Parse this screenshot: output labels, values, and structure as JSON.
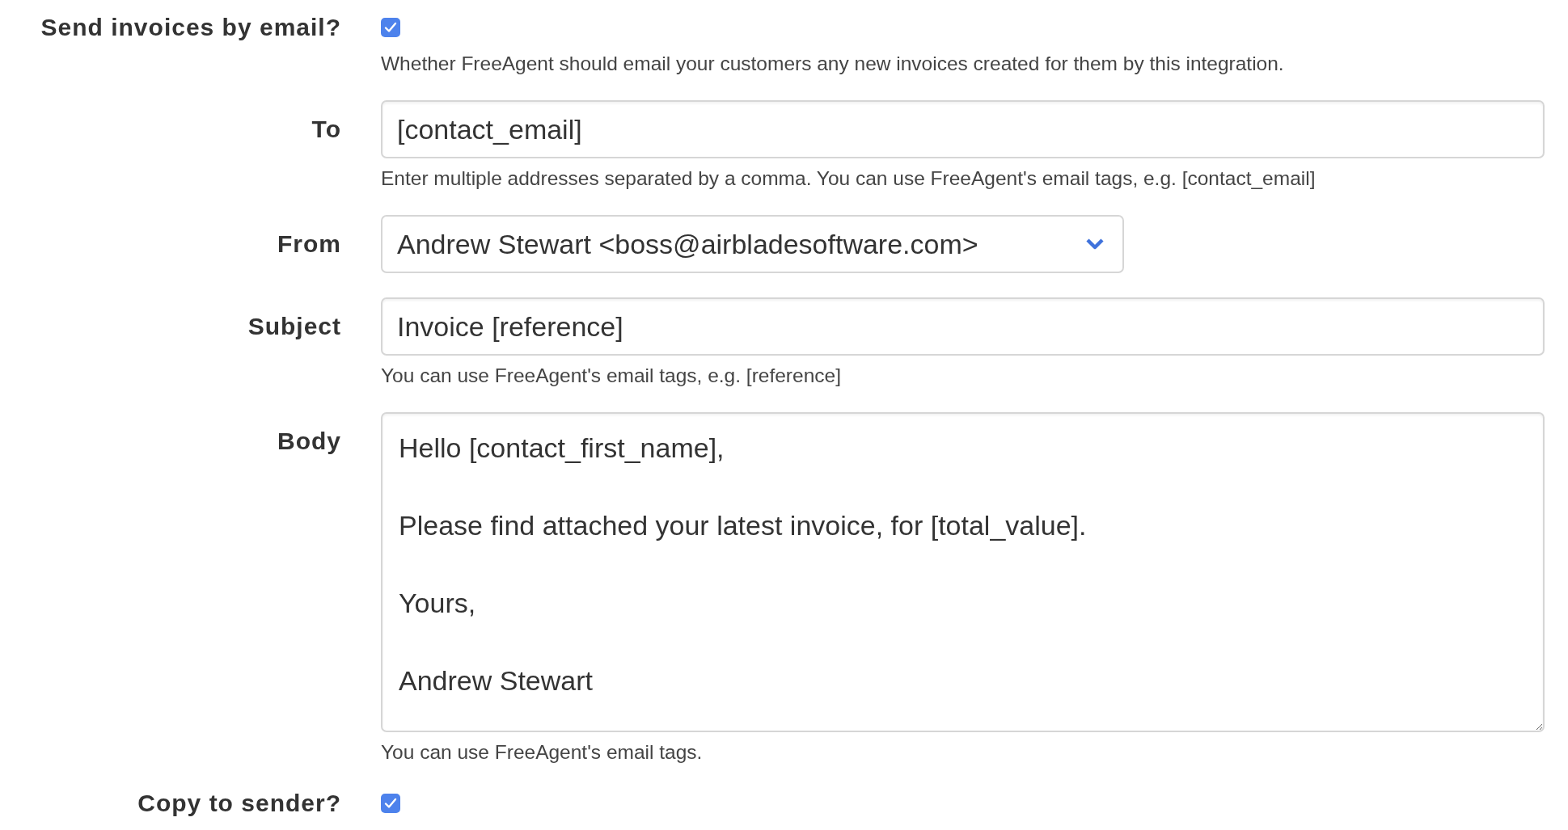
{
  "fields": [
    {
      "kind": "checkbox",
      "label": "Send invoices by email?",
      "checked": true,
      "help": "Whether FreeAgent should email your customers any new invoices created for them by this integration."
    },
    {
      "kind": "text",
      "label": "To",
      "value": "[contact_email]",
      "help": "Enter multiple addresses separated by a comma. You can use FreeAgent's email tags, e.g. [contact_email]"
    },
    {
      "kind": "select",
      "label": "From",
      "value": "Andrew Stewart <boss@airbladesoftware.com>"
    },
    {
      "kind": "text",
      "label": "Subject",
      "value": "Invoice [reference]",
      "help": "You can use FreeAgent's email tags, e.g. [reference]"
    },
    {
      "kind": "textarea",
      "label": "Body",
      "value": "Hello [contact_first_name],\n\nPlease find attached your latest invoice, for [total_value].\n\nYours,\n\nAndrew Stewart",
      "help": "You can use FreeAgent's email tags."
    },
    {
      "kind": "checkbox",
      "label": "Copy to sender?",
      "checked": true
    }
  ]
}
